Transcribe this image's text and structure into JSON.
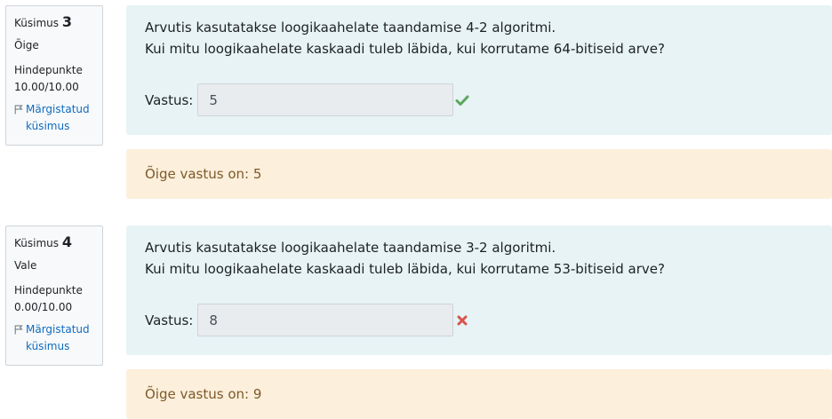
{
  "questions": [
    {
      "label": "Küsimus",
      "number": "3",
      "state": "Õige",
      "grade_label": "Hindepunkte",
      "grade_value": "10.00/10.00",
      "flag_label_1": "Märgistatud",
      "flag_label_2": "küsimus",
      "text_line_1": "Arvutis kasutatakse loogikaahelate taandamise 4-2 algoritmi.",
      "text_line_2": "Kui mitu loogikaahelate kaskaadi tuleb läbida, kui korrutame 64-bitiseid arve?",
      "answer_label": "Vastus:",
      "answer_value": "5",
      "result_icon": "check-icon",
      "result_color": "#5aa85c",
      "right_answer": "Õige vastus on: 5"
    },
    {
      "label": "Küsimus",
      "number": "4",
      "state": "Vale",
      "grade_label": "Hindepunkte",
      "grade_value": "0.00/10.00",
      "flag_label_1": "Märgistatud",
      "flag_label_2": "küsimus",
      "text_line_1": "Arvutis kasutatakse loogikaahelate taandamise 3-2 algoritmi.",
      "text_line_2": "Kui mitu loogikaahelate kaskaadi tuleb läbida, kui korrutame 53-bitiseid arve?",
      "answer_label": "Vastus:",
      "answer_value": "8",
      "result_icon": "cross-icon",
      "result_color": "#d9534f",
      "right_answer": "Õige vastus on: 9"
    }
  ],
  "colors": {
    "formulation_bg": "#e7f3f5",
    "feedback_bg": "#fcefdc",
    "link": "#0f6cbf"
  }
}
